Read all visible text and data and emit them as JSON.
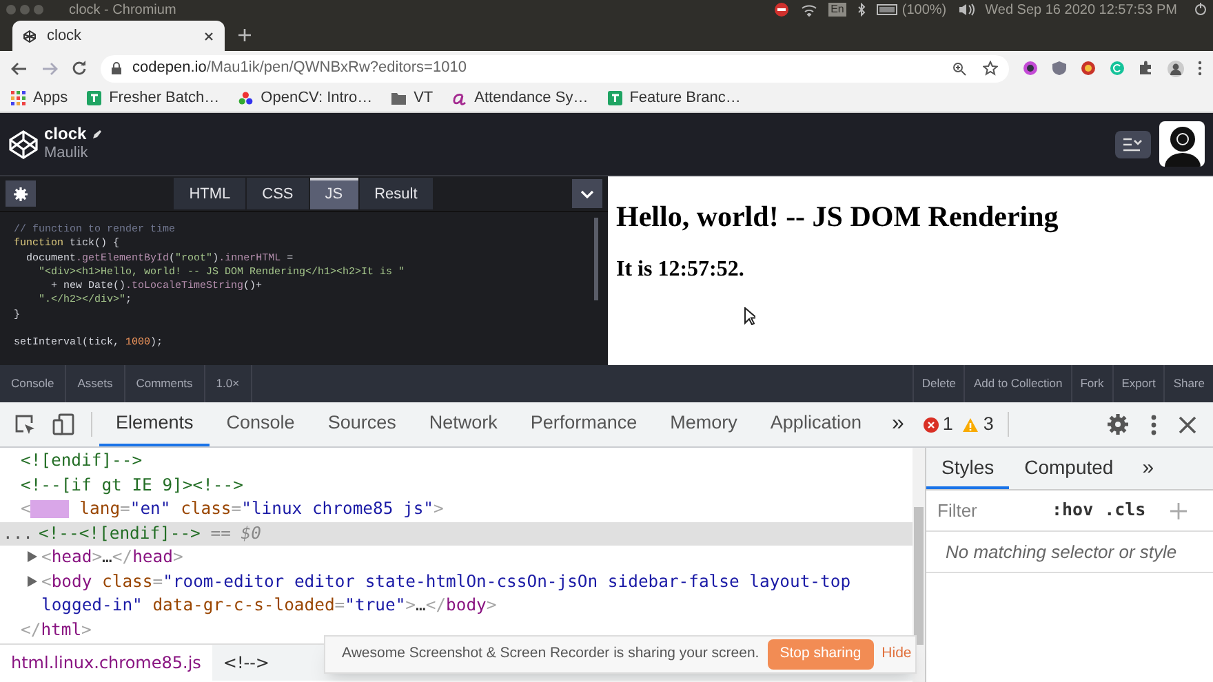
{
  "os_bar": {
    "window_title": "clock - Chromium",
    "language": "En",
    "battery": "(100%)",
    "datetime": "Wed Sep 16 2020 12:57:53 PM"
  },
  "browser": {
    "tabs": [
      {
        "label": "clock",
        "selected": true
      }
    ],
    "url_host": "codepen.io",
    "url_path": "/Mau1ik/pen/QWNBxRw?editors=1010",
    "bookmarks": [
      {
        "label": "Apps",
        "kind": "apps"
      },
      {
        "label": "Fresher Batch…",
        "kind": "sheet"
      },
      {
        "label": "OpenCV: Intro…",
        "kind": "logo"
      },
      {
        "label": "VT",
        "kind": "folder"
      },
      {
        "label": "Attendance Sy…",
        "kind": "letter"
      },
      {
        "label": "Feature Branc…",
        "kind": "sheet"
      }
    ]
  },
  "codepen": {
    "title": "clock",
    "author": "Maulik",
    "editor_tabs": [
      {
        "label": "HTML",
        "selected": false
      },
      {
        "label": "CSS",
        "selected": false
      },
      {
        "label": "JS",
        "selected": true
      },
      {
        "label": "Result",
        "selected": false
      }
    ],
    "code_lines": [
      {
        "tokens": [
          {
            "kind": "comment",
            "text": "// function to render time"
          }
        ]
      },
      {
        "tokens": [
          {
            "kind": "keyword",
            "text": "function"
          },
          {
            "kind": "plain",
            "text": " tick() {"
          }
        ]
      },
      {
        "tokens": [
          {
            "kind": "plain",
            "text": "  document"
          },
          {
            "kind": "prop",
            "text": ".getElementById"
          },
          {
            "kind": "plain",
            "text": "("
          },
          {
            "kind": "string",
            "text": "\"root\""
          },
          {
            "kind": "plain",
            "text": ")"
          },
          {
            "kind": "prop",
            "text": ".innerHTML"
          },
          {
            "kind": "plain",
            "text": " ="
          }
        ]
      },
      {
        "tokens": [
          {
            "kind": "string",
            "text": "    \"<div><h1>Hello, world! -- JS DOM Rendering</h1><h2>It is \""
          }
        ]
      },
      {
        "tokens": [
          {
            "kind": "plain",
            "text": "      + new Date()"
          },
          {
            "kind": "prop",
            "text": ".toLocaleTimeString"
          },
          {
            "kind": "plain",
            "text": "()+"
          }
        ]
      },
      {
        "tokens": [
          {
            "kind": "string",
            "text": "    \".</h2></div>\""
          },
          {
            "kind": "plain",
            "text": ";"
          }
        ]
      },
      {
        "tokens": [
          {
            "kind": "plain",
            "text": "}"
          }
        ]
      },
      {
        "blank_before": true,
        "tokens": [
          {
            "kind": "plain",
            "text": "setInterval(tick, "
          },
          {
            "kind": "number",
            "text": "1000"
          },
          {
            "kind": "plain",
            "text": ");"
          }
        ]
      }
    ],
    "footer_left": [
      "Console",
      "Assets",
      "Comments",
      "1.0×"
    ],
    "footer_right": [
      "Delete",
      "Add to Collection",
      "Fork",
      "Export",
      "Share"
    ]
  },
  "preview": {
    "heading": "Hello, world! -- JS DOM Rendering",
    "subheading": "It is 12:57:52."
  },
  "devtools": {
    "tabs": [
      {
        "label": "Elements",
        "selected": true
      },
      {
        "label": "Console",
        "selected": false
      },
      {
        "label": "Sources",
        "selected": false
      },
      {
        "label": "Network",
        "selected": false
      },
      {
        "label": "Performance",
        "selected": false
      },
      {
        "label": "Memory",
        "selected": false
      },
      {
        "label": "Application",
        "selected": false
      }
    ],
    "more": "»",
    "errors": "1",
    "warnings": "3",
    "dom_lines": [
      {
        "selected": false,
        "tokens": [
          {
            "kind": "comment",
            "text": "<![endif]-->"
          }
        ]
      },
      {
        "selected": false,
        "tokens": [
          {
            "kind": "comment",
            "text": "<!--[if gt IE 9]><!-->"
          }
        ]
      },
      {
        "selected": false,
        "masked_tag": true,
        "tokens": [
          {
            "kind": "bracket",
            "text": "<"
          },
          {
            "kind": "attr",
            "text": " lang"
          },
          {
            "kind": "bracket",
            "text": "="
          },
          {
            "kind": "value",
            "text": "\"en\""
          },
          {
            "kind": "attr",
            "text": " class"
          },
          {
            "kind": "bracket",
            "text": "="
          },
          {
            "kind": "value",
            "text": "\"linux chrome85 js\""
          },
          {
            "kind": "bracket",
            "text": ">"
          }
        ]
      },
      {
        "selected": true,
        "gutter": "...",
        "tokens": [
          {
            "kind": "comment",
            "text": "<!--<![endif]-->"
          },
          {
            "kind": "hint",
            "text": " == $0"
          }
        ]
      },
      {
        "selected": false,
        "expanded": false,
        "tokens": [
          {
            "kind": "bracket",
            "text": "<"
          },
          {
            "kind": "tag",
            "text": "head"
          },
          {
            "kind": "bracket",
            "text": ">"
          },
          {
            "kind": "plain",
            "text": "…"
          },
          {
            "kind": "bracket",
            "text": "</"
          },
          {
            "kind": "tag",
            "text": "head"
          },
          {
            "kind": "bracket",
            "text": ">"
          }
        ]
      },
      {
        "selected": false,
        "expanded": false,
        "tokens": [
          {
            "kind": "bracket",
            "text": "<"
          },
          {
            "kind": "tag",
            "text": "body"
          },
          {
            "kind": "attr",
            "text": " class"
          },
          {
            "kind": "bracket",
            "text": "="
          },
          {
            "kind": "value",
            "text": "\"room-editor editor state-htmlOn-cssOn-jsOn sidebar-false   layout-top logged-in\""
          },
          {
            "kind": "attr",
            "text": " data-gr-c-s-loaded"
          },
          {
            "kind": "bracket",
            "text": "="
          },
          {
            "kind": "value",
            "text": "\"true\""
          },
          {
            "kind": "bracket",
            "text": ">"
          },
          {
            "kind": "plain",
            "text": "…"
          },
          {
            "kind": "bracket",
            "text": "</"
          },
          {
            "kind": "tag",
            "text": "body"
          },
          {
            "kind": "bracket",
            "text": ">"
          }
        ]
      },
      {
        "selected": false,
        "tokens": [
          {
            "kind": "bracket",
            "text": "</"
          },
          {
            "kind": "tag",
            "text": "html"
          },
          {
            "kind": "bracket",
            "text": ">"
          }
        ]
      }
    ],
    "breadcrumbs": [
      {
        "label": "html.linux.chrome85.js",
        "selected": true
      },
      {
        "label": "<!-->",
        "selected": false
      }
    ],
    "styles_tabs": [
      {
        "label": "Styles",
        "selected": true
      },
      {
        "label": "Computed",
        "selected": false
      }
    ],
    "styles_more": "»",
    "filter_placeholder": "Filter",
    "hov": ":hov",
    "cls": ".cls",
    "empty_message": "No matching selector or style"
  },
  "share_notice": {
    "message": "Awesome Screenshot & Screen Recorder is sharing your screen.",
    "stop_button": "Stop sharing",
    "hide_link": "Hide"
  }
}
